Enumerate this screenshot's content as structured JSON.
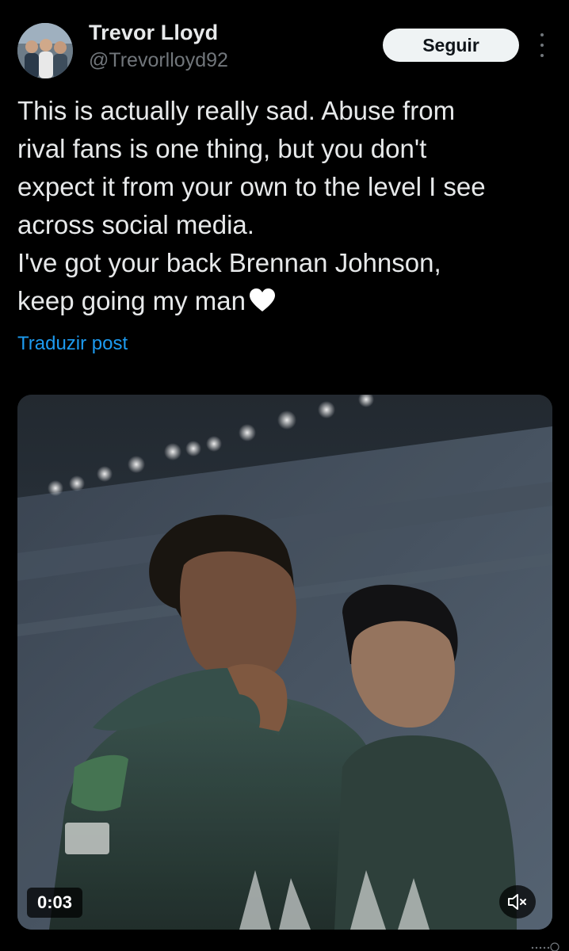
{
  "author": {
    "display_name": "Trevor Lloyd",
    "handle": "@Trevorlloyd92",
    "avatar_icon": "profile-photo"
  },
  "actions": {
    "follow_label": "Seguir",
    "more_icon": "vertical-ellipsis-icon"
  },
  "post": {
    "text": "This is actually really sad. Abuse from\nrival fans is one thing, but you don't\nexpect it from your own to the level I see\nacross social media.\nI've got your back Brennan Johnson,\nkeep going my man",
    "emoji": "white-heart",
    "translate_label": "Traduzir post"
  },
  "media": {
    "type": "video",
    "duration": "0:03",
    "mute_icon": "speaker-muted-icon"
  },
  "colors": {
    "background": "#000000",
    "text_primary": "#e7e9ea",
    "text_secondary": "#71767b",
    "link": "#1d9bf0",
    "button_bg": "#eff3f4"
  }
}
